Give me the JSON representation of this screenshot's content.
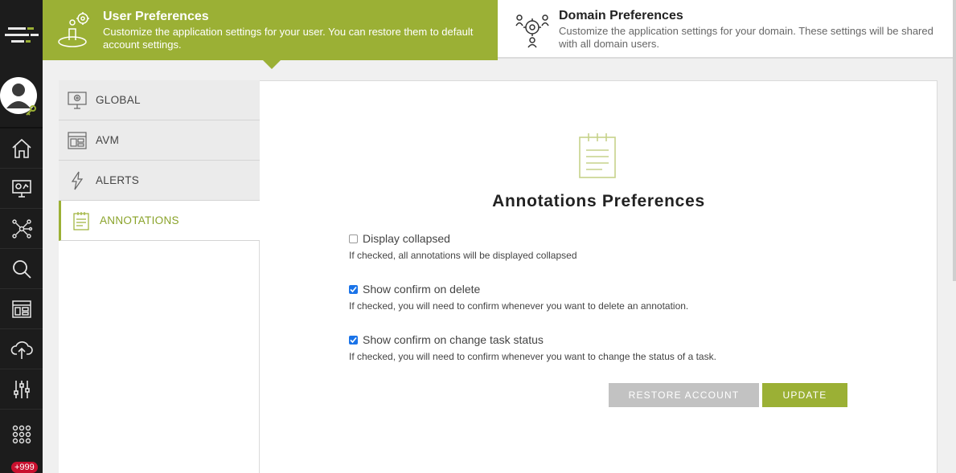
{
  "header": {
    "user_tab": {
      "title": "User Preferences",
      "description": "Customize the application settings for your user. You can restore them to default account settings."
    },
    "domain_tab": {
      "title": "Domain Preferences",
      "description": "Customize the application settings for your domain. These settings will be shared with all domain users."
    }
  },
  "rail": {
    "items": [
      "home-icon",
      "monitor-dashboard-icon",
      "network-icon",
      "search-icon",
      "layout-icon",
      "cloud-upload-icon",
      "sliders-icon",
      "apps-grid-icon"
    ],
    "notification_badge": "+999"
  },
  "sidebar": {
    "items": [
      {
        "label": "GLOBAL",
        "icon": "monitor-gear-icon"
      },
      {
        "label": "AVM",
        "icon": "avm-layout-icon"
      },
      {
        "label": "ALERTS",
        "icon": "lightning-icon"
      },
      {
        "label": "ANNOTATIONS",
        "icon": "notepad-icon",
        "active": true
      }
    ]
  },
  "main": {
    "title": "Annotations Preferences",
    "options": [
      {
        "label": "Display collapsed",
        "checked": false,
        "help": "If checked, all annotations will be displayed collapsed"
      },
      {
        "label": "Show confirm on delete",
        "checked": true,
        "help": "If checked, you will need to confirm whenever you want to delete an annotation."
      },
      {
        "label": "Show confirm on change task status",
        "checked": true,
        "help": "If checked, you will need to confirm whenever you want to change the status of a task."
      }
    ],
    "restore_label": "RESTORE ACCOUNT",
    "update_label": "UPDATE"
  },
  "colors": {
    "accent": "#9bb035",
    "rail": "#1c1c1c",
    "checkbox": "#1a73e8",
    "badge": "#c8102e"
  }
}
